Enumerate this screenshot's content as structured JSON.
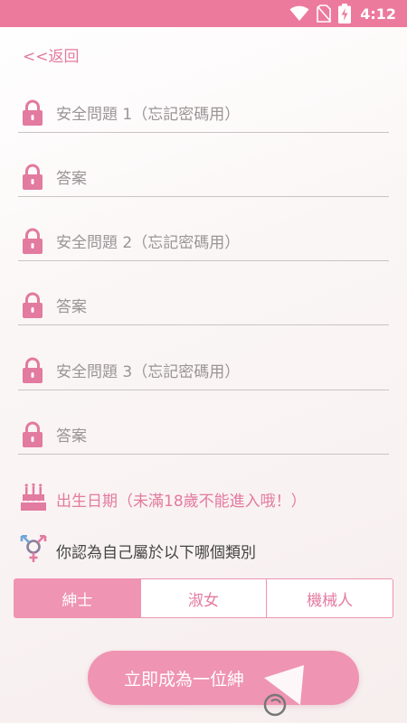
{
  "status_bar": {
    "time": "4:12",
    "icons": [
      "wifi-icon",
      "no-sim-icon",
      "battery-charging-icon"
    ]
  },
  "nav": {
    "back_label": "<<返回"
  },
  "form": {
    "fields": [
      {
        "placeholder": "安全問題 1（忘記密碼用）",
        "icon": "lock-icon"
      },
      {
        "placeholder": "答案",
        "icon": "lock-icon"
      },
      {
        "placeholder": "安全問題 2（忘記密碼用）",
        "icon": "lock-icon"
      },
      {
        "placeholder": "答案",
        "icon": "lock-icon"
      },
      {
        "placeholder": "安全問題 3（忘記密碼用）",
        "icon": "lock-icon"
      },
      {
        "placeholder": "答案",
        "icon": "lock-icon"
      }
    ],
    "birthday_label": "出生日期（未滿18歲不能進入哦！）",
    "gender_prompt": "你認為自己屬於以下哪個類別",
    "gender_options": [
      "紳士",
      "淑女",
      "機械人"
    ],
    "gender_selected": "紳士",
    "submit_label": "立即成為一位紳"
  },
  "colors": {
    "status_bar": "#ec7a9c",
    "accent": "#e37aa0",
    "button": "#ef94b3",
    "placeholder": "#9a9496",
    "divider": "#c9c3c5"
  }
}
